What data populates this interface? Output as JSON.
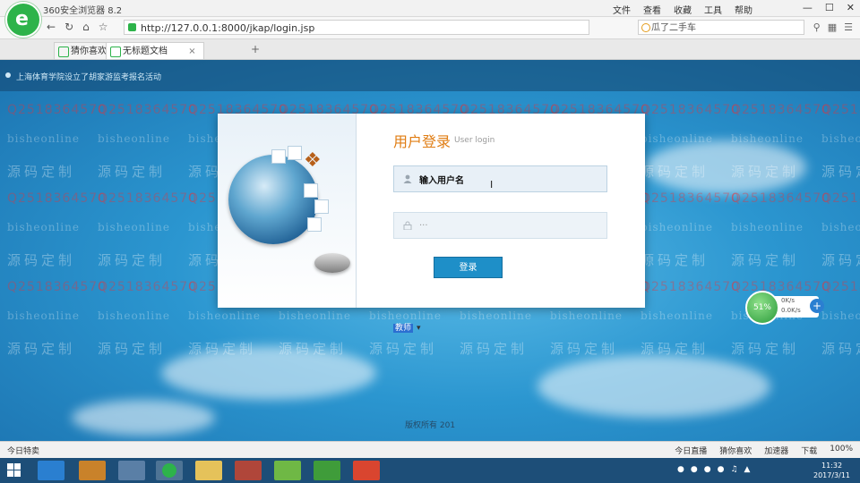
{
  "browser": {
    "title": "360安全浏览器 8.2",
    "menu": [
      "文件",
      "查看",
      "收藏",
      "工具",
      "帮助"
    ],
    "url": "http://127.0.0.1:8000/jkap/login.jsp",
    "search_text": "瓜了二手车",
    "tabs": [
      {
        "label": "猜你喜欢"
      },
      {
        "label": "无标题文档"
      }
    ]
  },
  "page": {
    "notice": "上海体育学院设立了胡家游监考报名活动",
    "login": {
      "title": "用户登录",
      "subtitle": "User login",
      "username_value": "输入用户名",
      "password_value": "···",
      "role_selected": "教师",
      "submit_label": "登录"
    },
    "copyright": "版权所有 201",
    "watermarks": {
      "latin": "bisheonline",
      "qq": "Q2518364570",
      "cn": "源码定制"
    }
  },
  "speed_widget": {
    "percent": "51%",
    "up": "0K/s",
    "down": "0.0K/s"
  },
  "statusbar": {
    "left": "今日特卖",
    "right": [
      "今日直播",
      "猜你喜欢",
      "加速器",
      "下载",
      "100%"
    ]
  },
  "taskbar": {
    "time": "11:32",
    "date": "2017/3/11"
  },
  "colors": {
    "accent_orange": "#e07c12",
    "button_blue": "#1e8fc8",
    "brand_green": "#2db34a"
  }
}
